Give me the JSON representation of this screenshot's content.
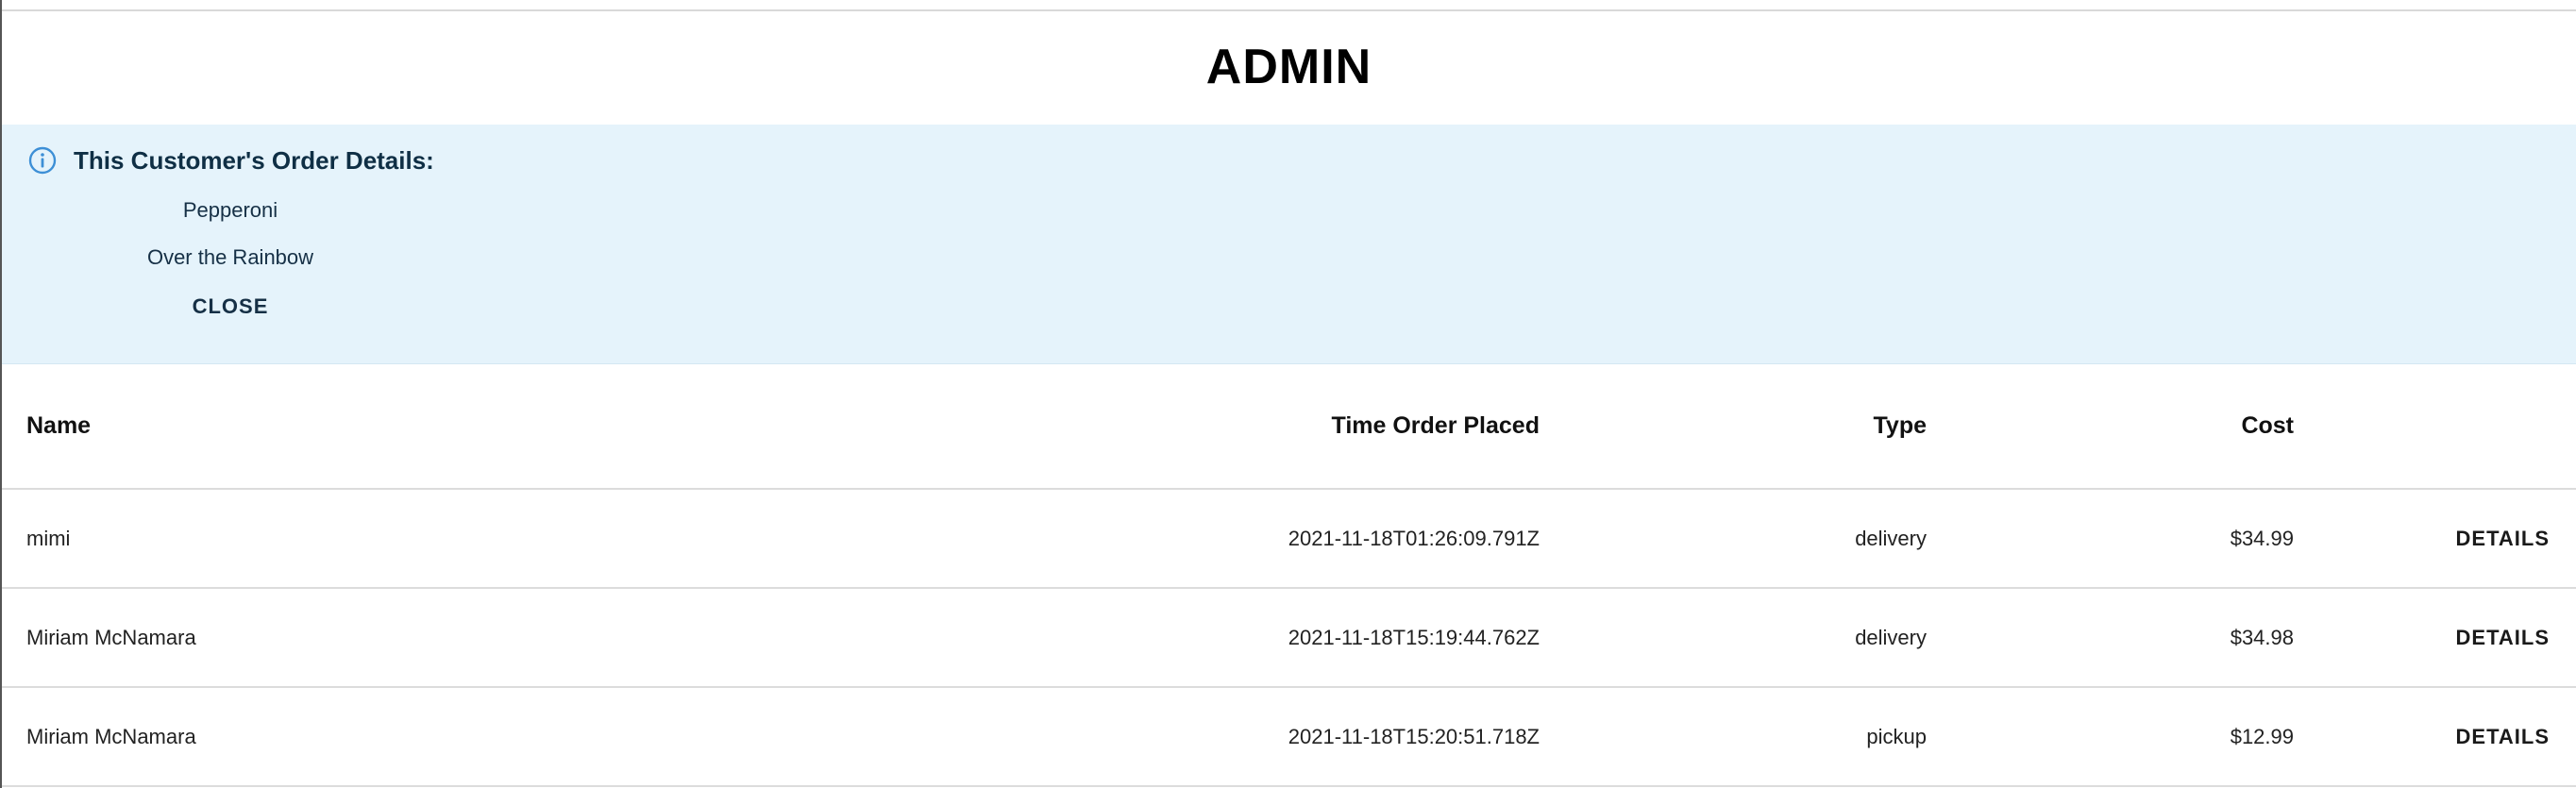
{
  "header": {
    "title": "ADMIN"
  },
  "alert": {
    "icon": "info-icon",
    "accent_color": "#3d8fd6",
    "background_color": "#e5f3fb",
    "heading": "This Customer's Order Details:",
    "items": [
      "Pepperoni",
      "Over the Rainbow"
    ],
    "close_label": "CLOSE"
  },
  "orders_table": {
    "columns": [
      "Name",
      "Time Order Placed",
      "Type",
      "Cost",
      ""
    ],
    "rows": [
      {
        "name": "mimi",
        "time": "2021-11-18T01:26:09.791Z",
        "type": "delivery",
        "cost": "$34.99",
        "action": "DETAILS"
      },
      {
        "name": "Miriam McNamara",
        "time": "2021-11-18T15:19:44.762Z",
        "type": "delivery",
        "cost": "$34.98",
        "action": "DETAILS"
      },
      {
        "name": "Miriam McNamara",
        "time": "2021-11-18T15:20:51.718Z",
        "type": "pickup",
        "cost": "$12.99",
        "action": "DETAILS"
      }
    ]
  }
}
